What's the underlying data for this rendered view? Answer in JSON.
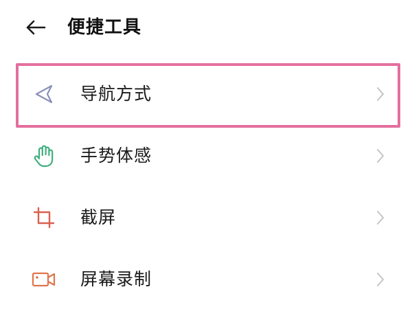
{
  "header": {
    "title": "便捷工具",
    "back_icon": "back-arrow-icon"
  },
  "menu": {
    "items": [
      {
        "label": "导航方式",
        "icon": "navigation-arrow-icon",
        "icon_color": "#8a8fb8",
        "highlighted": true
      },
      {
        "label": "手势体感",
        "icon": "hand-gesture-icon",
        "icon_color": "#3fae7e",
        "highlighted": false
      },
      {
        "label": "截屏",
        "icon": "crop-icon",
        "icon_color": "#d9604f",
        "highlighted": false
      },
      {
        "label": "屏幕录制",
        "icon": "video-camera-icon",
        "icon_color": "#e0744a",
        "highlighted": false
      }
    ]
  },
  "colors": {
    "highlight_border": "#e46f9e",
    "chevron": "#c4c4c4",
    "text": "#1a1a1a"
  }
}
